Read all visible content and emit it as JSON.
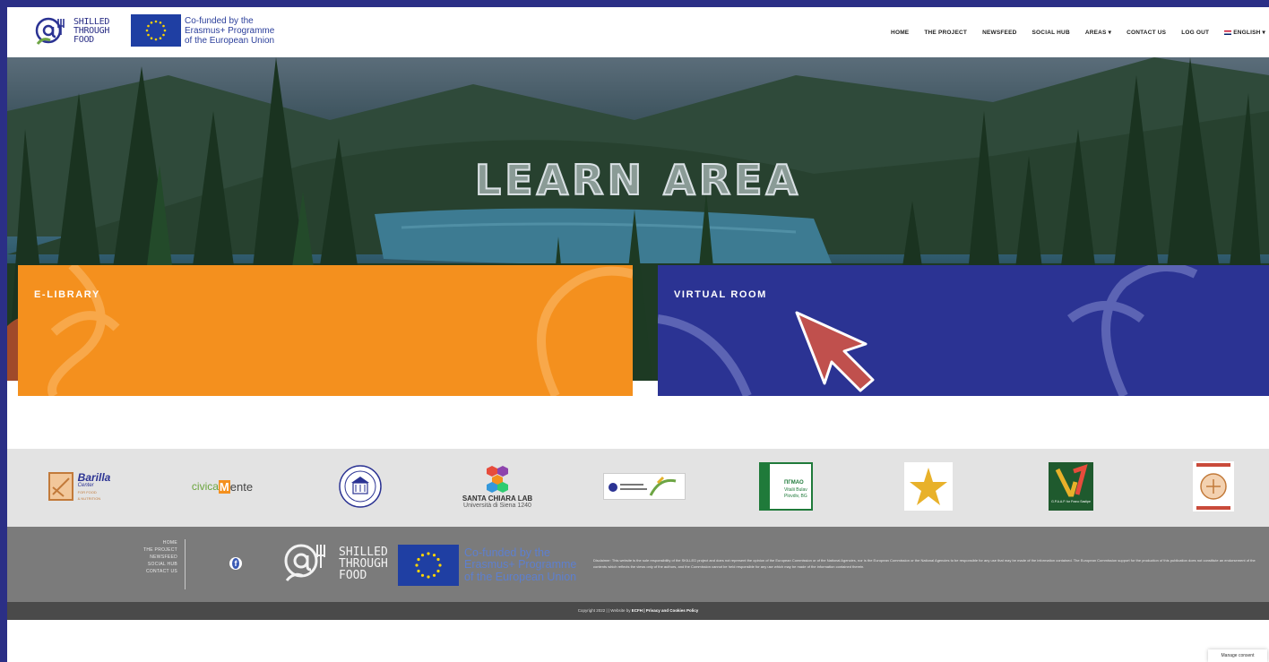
{
  "header": {
    "logo_text": [
      "SHILLED",
      "THROUGH",
      "FOOD"
    ],
    "eu_text": [
      "Co-funded by the",
      "Erasmus+ Programme",
      "of the European Union"
    ],
    "nav": [
      "HOME",
      "THE PROJECT",
      "NEWSFEED",
      "SOCIAL HUB",
      "AREAS ▾",
      "CONTACT US",
      "LOG OUT",
      "ENGLISH ▾"
    ]
  },
  "hero": {
    "title": "LEARN AREA"
  },
  "cards": [
    {
      "label": "E-LIBRARY",
      "color": "#f4901e"
    },
    {
      "label": "VIRTUAL ROOM",
      "color": "#2b3393"
    }
  ],
  "partners": {
    "barilla_name": "Barilla",
    "barilla_sub": [
      "Center",
      "FOR FOOD",
      "& NUTRITION"
    ],
    "civica": [
      "civica",
      "M",
      "ente"
    ],
    "santa_chiara": [
      "SANTA CHIARA LAB",
      "Università di Siena 1240"
    ],
    "pgmao": [
      "ПГМАО",
      "Vitalii Bulav",
      "Plovdiv, BG"
    ],
    "gpaa": "G.P.A.A.P. for Frano Sastipe"
  },
  "footer": {
    "links": [
      "HOME",
      "THE PROJECT",
      "NEWSFEED",
      "SOCIAL HUB",
      "CONTACT US"
    ],
    "logo_text": [
      "SHILLED",
      "THROUGH",
      "FOOD"
    ],
    "eu_text": [
      "Co-funded by the",
      "Erasmus+ Programme",
      "of the European Union"
    ],
    "disclaimer": "Disclaimer: This website is the sole responsibility of the SKILLED project and does not represent the opinion of the European Commission or of the National Agencies, nor is the European Commission or the National Agencies to be responsible for any use that may be made of the information contained. The European Commission support for the production of this publication does not constitute an endorsement of the contents which reflects the views only of the authors, and the Commission cannot be held responsible for any use which may be made of the information contained therein.",
    "copyright_prefix": "Copyright 2022 | | Website by",
    "copyright_brand": "ECFH",
    "copyright_suffix": "| Privacy and Cookies Policy"
  },
  "consent": "Manage consent",
  "colors": {
    "brand_blue": "#2b3393",
    "brand_orange": "#f4901e",
    "frame": "#2b2f86",
    "cursor_red": "#c0504d"
  }
}
